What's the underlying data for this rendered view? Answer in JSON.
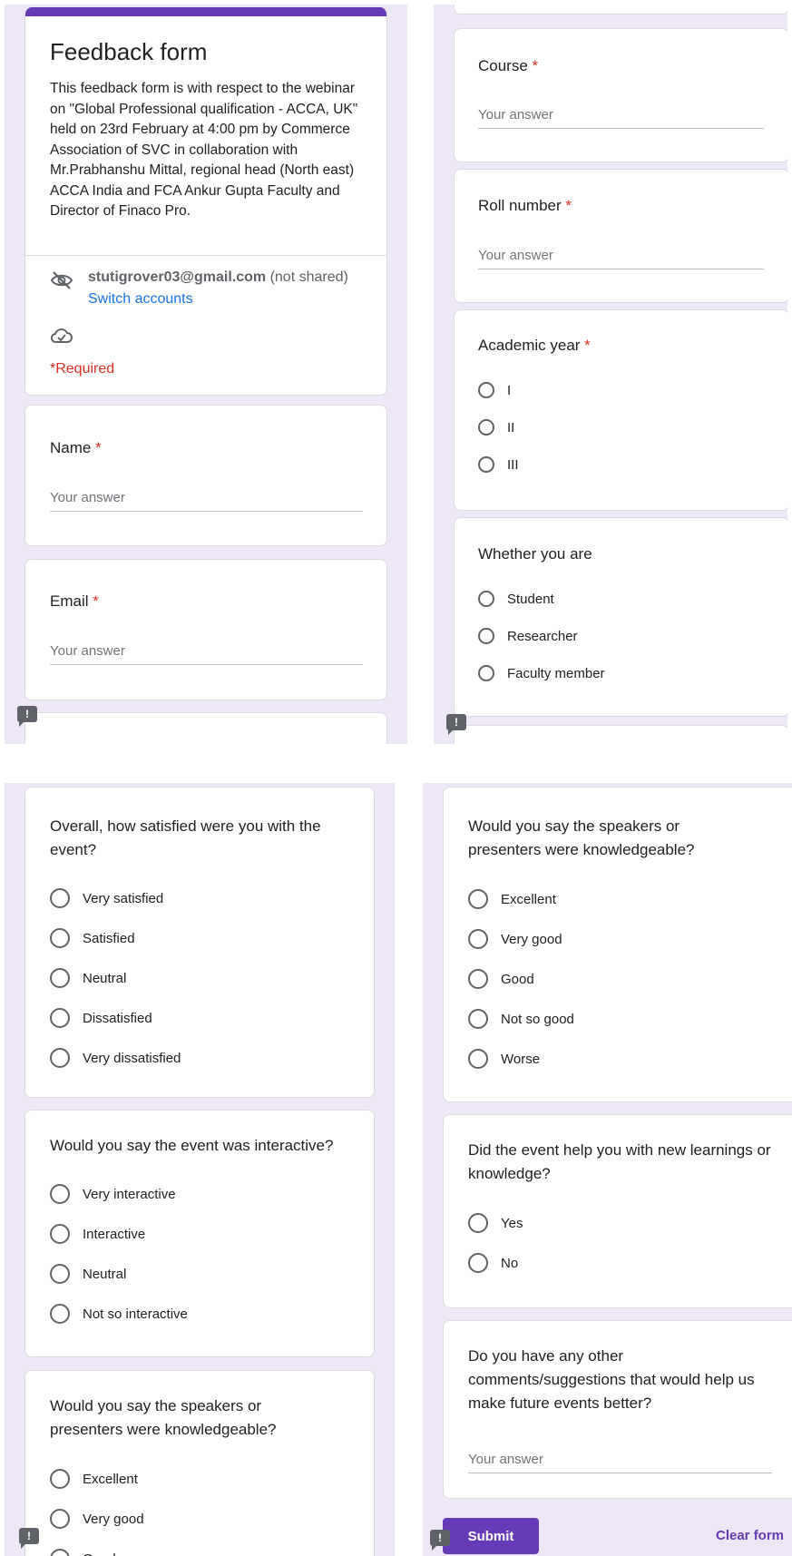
{
  "form": {
    "title": "Feedback form",
    "description": " This feedback form is with respect to the webinar on \"Global Professional qualification - ACCA, UK\" held on 23rd February at 4:00 pm by Commerce Association of SVC in collaboration with Mr.Prabhanshu Mittal, regional head (North east) ACCA India and FCA Ankur Gupta Faculty and Director of Finaco Pro.",
    "account_email": "stutigrover03@gmail.com",
    "not_shared": "(not shared)",
    "switch_accounts": "Switch accounts",
    "required_note": "*Required",
    "accent_color": "#673ab7",
    "background_color": "#ede7f6"
  },
  "common": {
    "placeholder": "Your answer",
    "required_star": "*",
    "feedback_glyph": "!"
  },
  "questions": {
    "name": "Name",
    "email": "Email",
    "course": "Course",
    "roll_number": "Roll number",
    "academic_year": {
      "title": "Academic year",
      "options": [
        "I",
        "II",
        "III"
      ]
    },
    "whether": {
      "title": "Whether you are",
      "options": [
        "Student",
        "Researcher",
        "Faculty member"
      ]
    },
    "satisfied": {
      "title": "Overall, how satisfied were you with the event?",
      "options": [
        "Very satisfied",
        "Satisfied",
        "Neutral",
        "Dissatisfied",
        "Very dissatisfied"
      ]
    },
    "interactive": {
      "title": "Would you say the event was interactive?",
      "options": [
        "Very interactive",
        "Interactive",
        "Neutral",
        "Not so interactive"
      ]
    },
    "knowledgeable": {
      "title": "Would you say the speakers or presenters were knowledgeable?",
      "options": [
        "Excellent",
        "Very good",
        "Good",
        "Not so good",
        "Worse"
      ]
    },
    "learnings": {
      "title": "Did the event help you with new learnings or knowledge?",
      "options": [
        "Yes",
        "No"
      ]
    },
    "comments": {
      "title": "Do you have any other comments/suggestions that would help us make future events better?"
    }
  },
  "actions": {
    "submit": "Submit",
    "clear": "Clear form"
  }
}
